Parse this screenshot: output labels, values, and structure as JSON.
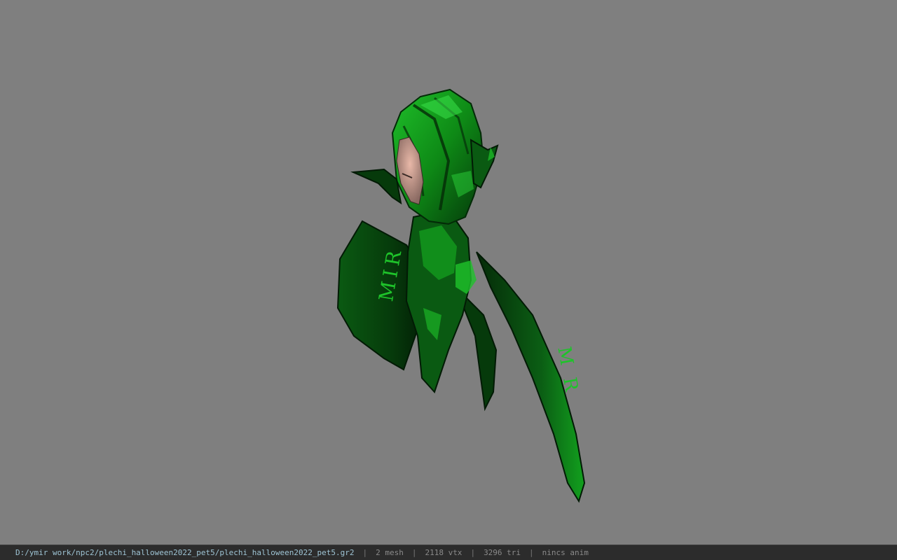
{
  "window": {
    "background_color": "#7f7f7f"
  },
  "model": {
    "rune_text_left": "MIR",
    "rune_text_right": "MR"
  },
  "statusbar": {
    "file_path": "D:/ymir work/npc2/plechi_halloween2022_pet5/plechi_halloween2022_pet5.gr2",
    "separator": "|",
    "mesh_count": "2 mesh",
    "vertex_count": "2118 vtx",
    "triangle_count": "3296 tri",
    "anim_status": "nincs anim"
  }
}
